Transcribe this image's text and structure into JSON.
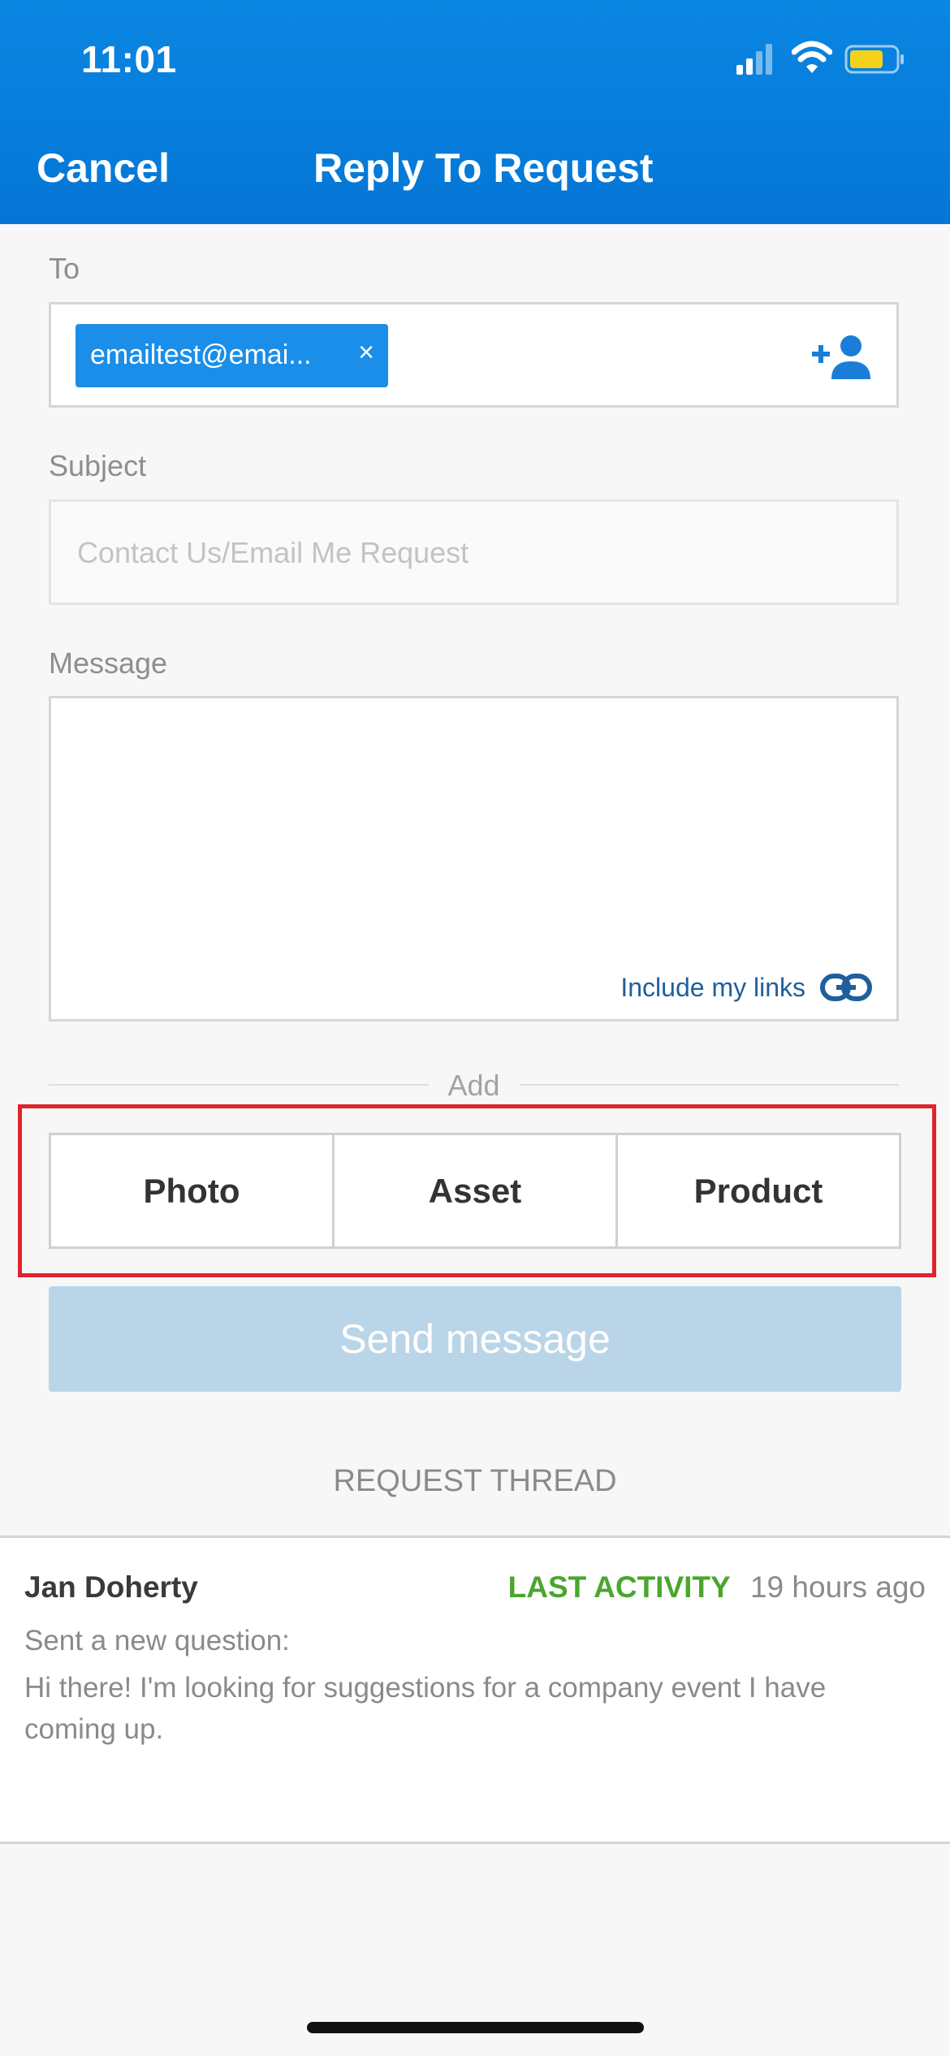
{
  "status_bar": {
    "time": "11:01"
  },
  "nav": {
    "cancel_label": "Cancel",
    "title": "Reply To Request"
  },
  "form": {
    "to_label": "To",
    "recipient_chip": "emailtest@emai...",
    "chip_remove": "×",
    "subject_label": "Subject",
    "subject_placeholder": "Contact Us/Email Me Request",
    "message_label": "Message",
    "include_links_label": "Include my links"
  },
  "attachments": {
    "add_label": "Add",
    "buttons": [
      "Photo",
      "Asset",
      "Product"
    ]
  },
  "send_button": "Send message",
  "thread": {
    "section_label": "REQUEST THREAD",
    "sender": "Jan Doherty",
    "last_activity_label": "LAST ACTIVITY",
    "last_activity_time": "19 hours ago",
    "action": "Sent a new question:",
    "message": "Hi there! I'm looking for suggestions for a company event I have coming up."
  },
  "colors": {
    "header": "#0a86e2",
    "chip": "#1a8ee8",
    "send_disabled": "#bad5e8",
    "activity_green": "#4aa62c",
    "highlight_red": "#e0232c"
  }
}
